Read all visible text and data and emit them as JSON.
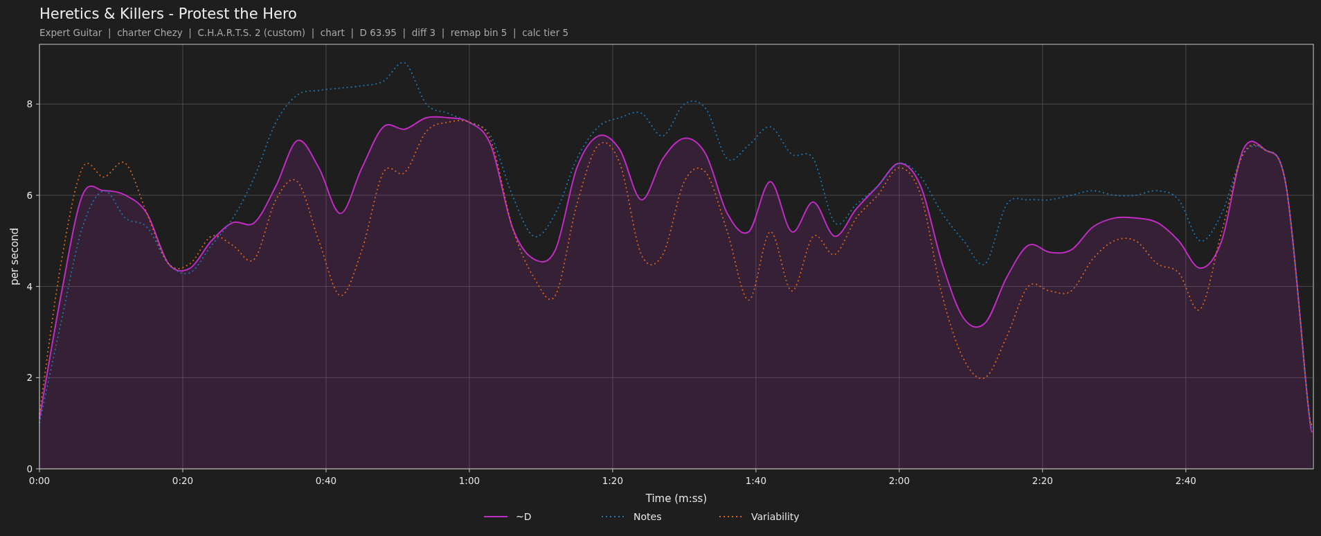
{
  "title": "Heretics & Killers - Protest the Hero",
  "subtitle": "Expert Guitar  |  charter Chezy  |  C.H.A.R.T.S. 2 (custom)  |  chart  |  D 63.95  |  diff 3  |  remap bin 5  |  calc tier 5",
  "chart_data": {
    "type": "line",
    "xlabel": "Time (m:ss)",
    "ylabel": "per second",
    "x": [
      0,
      3,
      6,
      9,
      12,
      15,
      18,
      21,
      24,
      27,
      30,
      33,
      36,
      39,
      42,
      45,
      48,
      51,
      54,
      57,
      60,
      63,
      66,
      69,
      72,
      75,
      78,
      81,
      84,
      87,
      90,
      93,
      96,
      99,
      102,
      105,
      108,
      111,
      114,
      117,
      120,
      123,
      126,
      129,
      132,
      135,
      138,
      141,
      144,
      147,
      150,
      153,
      156,
      159,
      162,
      165,
      168,
      171,
      174,
      177,
      177.6
    ],
    "xlim": [
      0,
      177.8
    ],
    "ylim": [
      0,
      9.31
    ],
    "xticks": [
      {
        "value": 0,
        "label": "0:00"
      },
      {
        "value": 20,
        "label": "0:20"
      },
      {
        "value": 40,
        "label": "0:40"
      },
      {
        "value": 60,
        "label": "1:00"
      },
      {
        "value": 80,
        "label": "1:20"
      },
      {
        "value": 100,
        "label": "1:40"
      },
      {
        "value": 120,
        "label": "2:00"
      },
      {
        "value": 140,
        "label": "2:20"
      },
      {
        "value": 160,
        "label": "2:40"
      }
    ],
    "yticks": [
      0,
      2,
      4,
      6,
      8
    ],
    "grid": true,
    "legend": true,
    "series": [
      {
        "name": "~D",
        "color": "#c02cc4",
        "type": "area",
        "line_style": "solid",
        "values": [
          1.1,
          3.8,
          6.0,
          6.1,
          6.0,
          5.6,
          4.5,
          4.4,
          5.0,
          5.4,
          5.4,
          6.2,
          7.2,
          6.6,
          5.6,
          6.6,
          7.5,
          7.45,
          7.7,
          7.7,
          7.6,
          7.1,
          5.3,
          4.6,
          4.8,
          6.6,
          7.3,
          7.0,
          5.9,
          6.8,
          7.25,
          6.9,
          5.6,
          5.2,
          6.3,
          5.2,
          5.85,
          5.1,
          5.7,
          6.2,
          6.7,
          6.2,
          4.5,
          3.3,
          3.2,
          4.2,
          4.9,
          4.75,
          4.8,
          5.3,
          5.5,
          5.5,
          5.4,
          5.0,
          4.4,
          5.0,
          7.0,
          7.0,
          6.2,
          1.5,
          0.8
        ]
      },
      {
        "name": "Notes",
        "color": "#1f77b4",
        "line_style": "dotted",
        "values": [
          1.0,
          3.2,
          5.3,
          6.1,
          5.5,
          5.3,
          4.5,
          4.3,
          4.9,
          5.5,
          6.4,
          7.6,
          8.2,
          8.3,
          8.35,
          8.4,
          8.5,
          8.9,
          8.0,
          7.8,
          7.6,
          7.3,
          6.0,
          5.1,
          5.6,
          6.8,
          7.5,
          7.7,
          7.8,
          7.3,
          8.0,
          7.9,
          6.8,
          7.1,
          7.5,
          6.9,
          6.8,
          5.4,
          5.8,
          6.2,
          6.7,
          6.4,
          5.6,
          5.0,
          4.5,
          5.8,
          5.9,
          5.9,
          6.0,
          6.1,
          6.0,
          6.0,
          6.1,
          5.9,
          5.0,
          5.6,
          6.9,
          7.0,
          6.2,
          1.5,
          0.9
        ]
      },
      {
        "name": "Variability",
        "color": "#d9671c",
        "line_style": "dotted",
        "values": [
          1.2,
          4.5,
          6.6,
          6.4,
          6.7,
          5.6,
          4.5,
          4.5,
          5.1,
          4.9,
          4.6,
          5.9,
          6.3,
          5.0,
          3.8,
          4.8,
          6.5,
          6.5,
          7.4,
          7.6,
          7.6,
          7.2,
          5.3,
          4.2,
          3.8,
          5.8,
          7.1,
          6.7,
          4.7,
          4.7,
          6.3,
          6.5,
          5.2,
          3.7,
          5.2,
          3.9,
          5.1,
          4.7,
          5.5,
          6.0,
          6.6,
          6.0,
          3.8,
          2.4,
          2.0,
          2.9,
          4.0,
          3.9,
          3.9,
          4.6,
          5.0,
          5.0,
          4.5,
          4.3,
          3.5,
          5.2,
          6.9,
          7.0,
          6.2,
          1.5,
          1.0
        ]
      }
    ]
  }
}
